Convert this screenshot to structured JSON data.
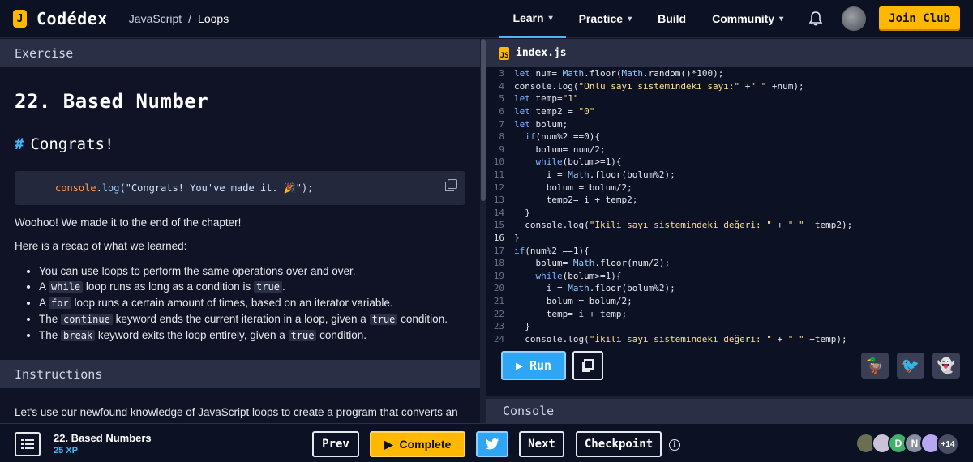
{
  "brand": {
    "logo_letter": "J",
    "name": "Codédex"
  },
  "breadcrumb": {
    "course": "JavaScript",
    "separator": "/",
    "chapter": "Loops"
  },
  "nav": [
    {
      "label": "Learn",
      "dropdown": true,
      "active": true
    },
    {
      "label": "Practice",
      "dropdown": true,
      "active": false
    },
    {
      "label": "Build",
      "dropdown": false,
      "active": false
    },
    {
      "label": "Community",
      "dropdown": true,
      "active": false
    }
  ],
  "join_label": "Join Club",
  "exercise": {
    "header": "Exercise",
    "title": "22. Based Number",
    "subheading_hash": "#",
    "subheading": "Congrats!",
    "snippet": {
      "obj": "console",
      "dot": ".",
      "fn": "log",
      "arg": "(\"Congrats! You've made it. 🎉\");"
    },
    "intro": "Woohoo! We made it to the end of the chapter!",
    "recap_intro": "Here is a recap of what we learned:",
    "recap": [
      {
        "pre": "You can use loops to perform the same operations over and over.",
        "code": "",
        "mid": "",
        "code2": "",
        "post": ""
      },
      {
        "pre": "A ",
        "code": "while",
        "mid": " loop runs as long as a condition is ",
        "code2": "true",
        "post": "."
      },
      {
        "pre": "A ",
        "code": "for",
        "mid": " loop runs a certain amount of times, based on an iterator variable.",
        "code2": "",
        "post": ""
      },
      {
        "pre": "The ",
        "code": "continue",
        "mid": " keyword ends the current iteration in a loop, given a ",
        "code2": "true",
        "post": " condition."
      },
      {
        "pre": "The ",
        "code": "break",
        "mid": " keyword exits the loop entirely, given a ",
        "code2": "true",
        "post": " condition."
      }
    ],
    "instructions_header": "Instructions",
    "instructions_text": "Let's use our newfound knowledge of JavaScript loops to create a program that converts an"
  },
  "editor": {
    "filename": "index.js",
    "current_line": 16,
    "lines": [
      {
        "n": 3,
        "t": "let num= Math.floor(Math.random()*100);"
      },
      {
        "n": 4,
        "t": "console.log(\"Onlu sayı sistemindeki sayı:\" +\" \" +num);"
      },
      {
        "n": 5,
        "t": "let temp=\"1\""
      },
      {
        "n": 6,
        "t": "let temp2 = \"0\""
      },
      {
        "n": 7,
        "t": "let bolum;"
      },
      {
        "n": 8,
        "t": "  if(num%2 ==0){"
      },
      {
        "n": 9,
        "t": "    bolum= num/2;"
      },
      {
        "n": 10,
        "t": "    while(bolum>=1){"
      },
      {
        "n": 11,
        "t": "      i = Math.floor(bolum%2);"
      },
      {
        "n": 12,
        "t": "      bolum = bolum/2;"
      },
      {
        "n": 13,
        "t": "      temp2= i + temp2;"
      },
      {
        "n": 14,
        "t": "  }"
      },
      {
        "n": 15,
        "t": "  console.log(\"İkili sayı sistemindeki değeri: \" + \" \" +temp2);"
      },
      {
        "n": 16,
        "t": "}"
      },
      {
        "n": 17,
        "t": "if(num%2 ==1){"
      },
      {
        "n": 18,
        "t": "    bolum= Math.floor(num/2);"
      },
      {
        "n": 19,
        "t": "    while(bolum>=1){"
      },
      {
        "n": 20,
        "t": "      i = Math.floor(bolum%2);"
      },
      {
        "n": 21,
        "t": "      bolum = bolum/2;"
      },
      {
        "n": 22,
        "t": "      temp= i + temp;"
      },
      {
        "n": 23,
        "t": "  }"
      },
      {
        "n": 24,
        "t": "  console.log(\"İkili sayı sistemindeki değeri: \" + \" \" +temp);"
      }
    ],
    "run_label": "Run",
    "console_header": "Console"
  },
  "footer": {
    "lesson_name": "22. Based Numbers",
    "xp": "25 XP",
    "prev": "Prev",
    "complete": "Complete",
    "next": "Next",
    "checkpoint": "Checkpoint",
    "avatars": [
      {
        "label": "",
        "color": "#6a6f52"
      },
      {
        "label": "",
        "color": "#c9c2d8"
      },
      {
        "label": "D",
        "color": "#3fb06a"
      },
      {
        "label": "N",
        "color": "#8a8fa0"
      },
      {
        "label": "",
        "color": "#b8a6f0"
      }
    ],
    "more_count": "+14"
  },
  "colors": {
    "accent_blue": "#2fa5f5",
    "accent_yellow": "#ffb800",
    "panel_header": "#2a2f45",
    "bg": "#0f1325"
  }
}
